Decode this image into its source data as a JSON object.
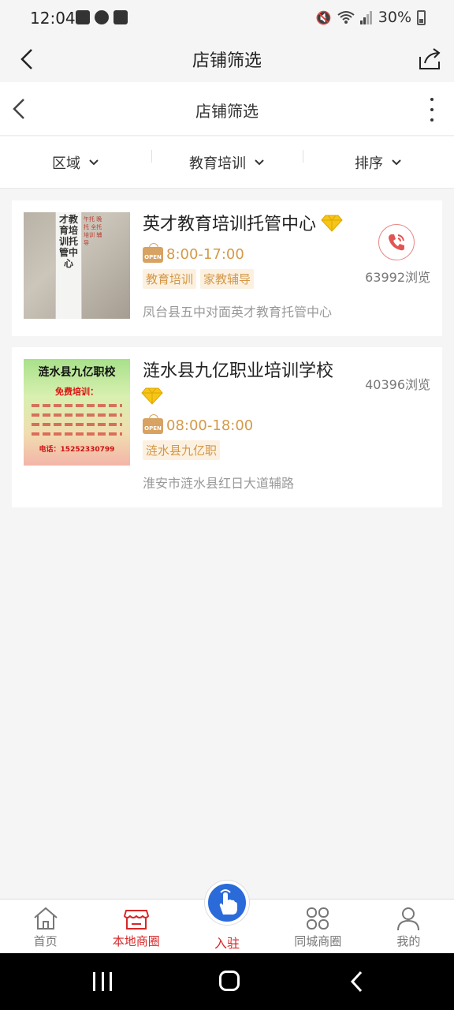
{
  "status_bar": {
    "time": "12:04",
    "battery": "30%"
  },
  "nav": {
    "title": "店铺筛选"
  },
  "inner_nav": {
    "title": "店铺筛选"
  },
  "filters": [
    {
      "label": "区域"
    },
    {
      "label": "教育培训"
    },
    {
      "label": "排序"
    }
  ],
  "shops": [
    {
      "name": "英才教育培训托管中心",
      "hours": "8:00-17:00",
      "tags": [
        "教育培训",
        "家教辅导"
      ],
      "address": "凤台县五中对面英才教育托管中心",
      "views": "63992浏览",
      "open_badge": "OPEN",
      "thumb_text": "才教育培训托管中心",
      "thumb_side_text": "午托 晚托 全托 培训 辅导"
    },
    {
      "name": "涟水县九亿职业培训学校",
      "hours": "08:00-18:00",
      "tags": [
        "涟水县九亿职"
      ],
      "address": "淮安市涟水县红日大道辅路",
      "views": "40396浏览",
      "open_badge": "OPEN",
      "thumb_title": "涟水县九亿职校",
      "thumb_sub": "免费培训：",
      "thumb_tel": "电话：15252330799"
    }
  ],
  "tab_bar": [
    {
      "label": "首页",
      "icon": "home-icon"
    },
    {
      "label": "本地商圈",
      "icon": "store-icon",
      "active": true
    },
    {
      "label": "入驻",
      "icon": "tap-hand-icon"
    },
    {
      "label": "同城商圈",
      "icon": "grid-icon"
    },
    {
      "label": "我的",
      "icon": "user-icon"
    }
  ],
  "colors": {
    "accent": "#d62828",
    "tag_text": "#d39747",
    "tag_bg": "#fcf1e1",
    "center_button": "#2a6bd9"
  }
}
